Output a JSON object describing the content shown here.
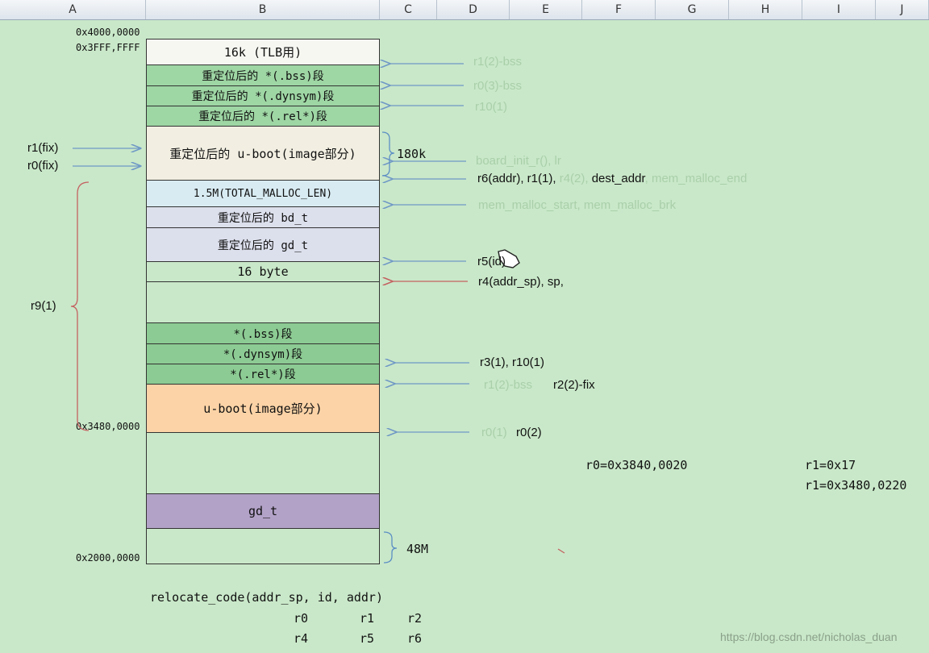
{
  "columns": [
    "A",
    "B",
    "C",
    "D",
    "E",
    "F",
    "G",
    "H",
    "I",
    "J"
  ],
  "addresses": {
    "top1": "0x4000,0000",
    "top2": "0x3FFF,FFFF",
    "mid": "0x3480,0000",
    "bottom": "0x2000,0000"
  },
  "blocks": [
    {
      "label": "16k (TLB用)"
    },
    {
      "label": "重定位后的 *(.bss)段"
    },
    {
      "label": "重定位后的 *(.dynsym)段"
    },
    {
      "label": "重定位后的 *(.rel*)段"
    },
    {
      "label": "重定位后的 u-boot(image部分)"
    },
    {
      "label": "1.5M(TOTAL_MALLOC_LEN)"
    },
    {
      "label": "重定位后的 bd_t"
    },
    {
      "label": "重定位后的 gd_t"
    },
    {
      "label": "16 byte"
    },
    {
      "label": ""
    },
    {
      "label": "*(.bss)段"
    },
    {
      "label": "*(.dynsym)段"
    },
    {
      "label": "*(.rel*)段"
    },
    {
      "label": "u-boot(image部分)"
    },
    {
      "label": ""
    },
    {
      "label": "gd_t"
    },
    {
      "label": ""
    }
  ],
  "side_labels": {
    "r1_fix": "r1(fix)",
    "r0_fix": "r0(fix)",
    "r9": "r9(1)",
    "size_180k": "180k",
    "size_48m": "48M"
  },
  "annotations": {
    "a1": "r1(2)-bss",
    "a2": "r0(3)-bss",
    "a3": "r10(1)",
    "a4": "board_init_r(), lr",
    "a5_dark": "r6(addr), r1(1), ",
    "a5_faint": "r4(2), ",
    "a5_dark2": "dest_addr",
    "a5_faint2": ", mem_malloc_end",
    "a6": "mem_malloc_start, mem_malloc_brk",
    "a7": "r5(id)",
    "a8": "r4(addr_sp), sp,",
    "a9": "r3(1), r10(1)",
    "a10_faint": "r1(2)-bss",
    "a10": "r2(2)-fix",
    "a11_faint": "r0(1)",
    "a11": "r0(2)"
  },
  "registers": {
    "r0": "r0=0x3840,0020",
    "r1a": "r1=0x17",
    "r1b": "r1=0x3480,0220"
  },
  "call": {
    "signature": "relocate_code(addr_sp, id, addr)",
    "row1": [
      "r0",
      "r1",
      "r2"
    ],
    "row2": [
      "r4",
      "r5",
      "r6"
    ]
  },
  "watermark": "https://blog.csdn.net/nicholas_duan",
  "colors": {
    "white": "#f7f7f2",
    "green": "#9ed6a4",
    "cream": "#f2efe2",
    "lightblue": "#d8ebf2",
    "lavender": "#dcdfec",
    "midgreen": "#8ccb93",
    "orange": "#fcd3a6",
    "purple": "#b3a2c8",
    "arrowblue": "#6f98c6",
    "arrowred": "#c46060"
  }
}
